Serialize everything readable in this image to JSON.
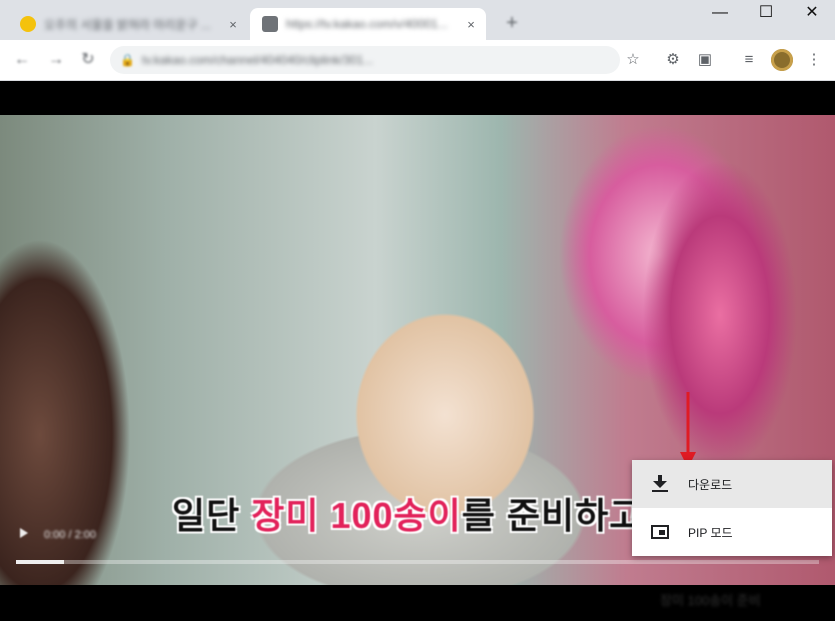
{
  "browser": {
    "tabs": [
      {
        "title": "오주의 서울을 밝혀라 마리운구 ...",
        "close": "×"
      },
      {
        "title": "https://tv.kakao.com/v/40001...",
        "close": "×"
      }
    ],
    "new_tab": "+",
    "window_controls": {
      "minimize": "—",
      "maximize": "☐",
      "close": "✕"
    },
    "nav": {
      "back": "←",
      "forward": "→",
      "reload": "↻"
    },
    "omnibox": {
      "lock": "🔒",
      "url": "tv.kakao.com/channel/404040/cliplink/301..."
    },
    "toolbar_icons": {
      "star": "☆",
      "extension": "⚙",
      "cast": "▣",
      "media": "≡",
      "menu": "⋮"
    }
  },
  "video": {
    "subtitle_prefix": "일단 ",
    "subtitle_accent": "장미 100송이",
    "subtitle_suffix": "를 준비하고",
    "time": "0:00 / 2:00",
    "progress": 0.06,
    "bottom_caption": "장미 100송이 준비"
  },
  "context_menu": {
    "items": [
      {
        "label": "다운로드",
        "icon": "download-icon"
      },
      {
        "label": "PIP 모드",
        "icon": "pip-icon"
      }
    ],
    "highlighted_index": 0
  },
  "colors": {
    "annotation": "#e01b24",
    "subtitle_accent": "#e2235b"
  }
}
